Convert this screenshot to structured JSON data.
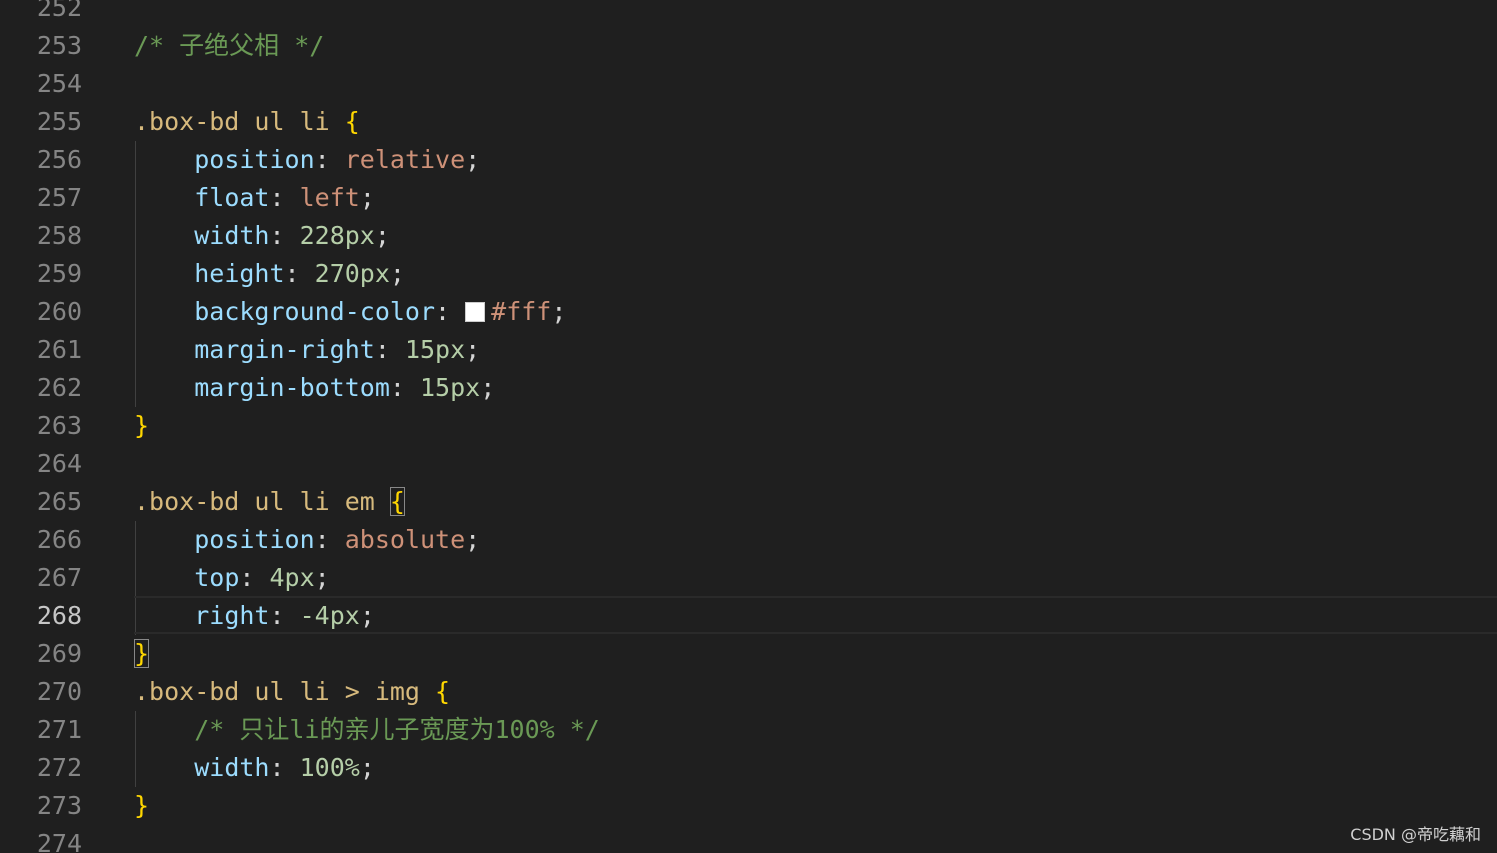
{
  "editor": {
    "current_line": "268",
    "lines": [
      {
        "num": "252",
        "tokens": []
      },
      {
        "num": "253",
        "tokens": [
          {
            "t": "comment",
            "v": "/* 子绝父相 */"
          }
        ]
      },
      {
        "num": "254",
        "tokens": []
      },
      {
        "num": "255",
        "tokens": [
          {
            "t": "sel",
            "v": ".box-bd ul li "
          },
          {
            "t": "brace",
            "v": "{"
          }
        ]
      },
      {
        "num": "256",
        "tokens": [
          {
            "t": "punc",
            "v": "    "
          },
          {
            "t": "prop",
            "v": "position"
          },
          {
            "t": "punc",
            "v": ": "
          },
          {
            "t": "val",
            "v": "relative"
          },
          {
            "t": "punc",
            "v": ";"
          }
        ]
      },
      {
        "num": "257",
        "tokens": [
          {
            "t": "punc",
            "v": "    "
          },
          {
            "t": "prop",
            "v": "float"
          },
          {
            "t": "punc",
            "v": ": "
          },
          {
            "t": "val",
            "v": "left"
          },
          {
            "t": "punc",
            "v": ";"
          }
        ]
      },
      {
        "num": "258",
        "tokens": [
          {
            "t": "punc",
            "v": "    "
          },
          {
            "t": "prop",
            "v": "width"
          },
          {
            "t": "punc",
            "v": ": "
          },
          {
            "t": "num",
            "v": "228px"
          },
          {
            "t": "punc",
            "v": ";"
          }
        ]
      },
      {
        "num": "259",
        "tokens": [
          {
            "t": "punc",
            "v": "    "
          },
          {
            "t": "prop",
            "v": "height"
          },
          {
            "t": "punc",
            "v": ": "
          },
          {
            "t": "num",
            "v": "270px"
          },
          {
            "t": "punc",
            "v": ";"
          }
        ]
      },
      {
        "num": "260",
        "tokens": [
          {
            "t": "punc",
            "v": "    "
          },
          {
            "t": "prop",
            "v": "background-color"
          },
          {
            "t": "punc",
            "v": ": "
          },
          {
            "t": "swatch",
            "v": ""
          },
          {
            "t": "val",
            "v": "#fff"
          },
          {
            "t": "punc",
            "v": ";"
          }
        ]
      },
      {
        "num": "261",
        "tokens": [
          {
            "t": "punc",
            "v": "    "
          },
          {
            "t": "prop",
            "v": "margin-right"
          },
          {
            "t": "punc",
            "v": ": "
          },
          {
            "t": "num",
            "v": "15px"
          },
          {
            "t": "punc",
            "v": ";"
          }
        ]
      },
      {
        "num": "262",
        "tokens": [
          {
            "t": "punc",
            "v": "    "
          },
          {
            "t": "prop",
            "v": "margin-bottom"
          },
          {
            "t": "punc",
            "v": ": "
          },
          {
            "t": "num",
            "v": "15px"
          },
          {
            "t": "punc",
            "v": ";"
          }
        ]
      },
      {
        "num": "263",
        "tokens": [
          {
            "t": "brace",
            "v": "}"
          }
        ]
      },
      {
        "num": "264",
        "tokens": []
      },
      {
        "num": "265",
        "tokens": [
          {
            "t": "sel",
            "v": ".box-bd ul li em "
          },
          {
            "t": "brace-box",
            "v": "{"
          }
        ]
      },
      {
        "num": "266",
        "tokens": [
          {
            "t": "punc",
            "v": "    "
          },
          {
            "t": "prop",
            "v": "position"
          },
          {
            "t": "punc",
            "v": ": "
          },
          {
            "t": "val",
            "v": "absolute"
          },
          {
            "t": "punc",
            "v": ";"
          }
        ]
      },
      {
        "num": "267",
        "tokens": [
          {
            "t": "punc",
            "v": "    "
          },
          {
            "t": "prop",
            "v": "top"
          },
          {
            "t": "punc",
            "v": ": "
          },
          {
            "t": "num",
            "v": "4px"
          },
          {
            "t": "punc",
            "v": ";"
          }
        ]
      },
      {
        "num": "268",
        "tokens": [
          {
            "t": "punc",
            "v": "    "
          },
          {
            "t": "prop",
            "v": "right"
          },
          {
            "t": "punc",
            "v": ": "
          },
          {
            "t": "num",
            "v": "-4px"
          },
          {
            "t": "punc",
            "v": ";"
          }
        ]
      },
      {
        "num": "269",
        "tokens": [
          {
            "t": "brace-box",
            "v": "}"
          }
        ]
      },
      {
        "num": "270",
        "tokens": [
          {
            "t": "sel",
            "v": ".box-bd ul li > img "
          },
          {
            "t": "brace",
            "v": "{"
          }
        ]
      },
      {
        "num": "271",
        "tokens": [
          {
            "t": "punc",
            "v": "    "
          },
          {
            "t": "comment",
            "v": "/* 只让li的亲儿子宽度为100% */"
          }
        ]
      },
      {
        "num": "272",
        "tokens": [
          {
            "t": "punc",
            "v": "    "
          },
          {
            "t": "prop",
            "v": "width"
          },
          {
            "t": "punc",
            "v": ": "
          },
          {
            "t": "num",
            "v": "100%"
          },
          {
            "t": "punc",
            "v": ";"
          }
        ]
      },
      {
        "num": "273",
        "tokens": [
          {
            "t": "brace",
            "v": "}"
          }
        ]
      },
      {
        "num": "274",
        "tokens": []
      }
    ]
  },
  "watermark": "CSDN @帝吃藕和"
}
